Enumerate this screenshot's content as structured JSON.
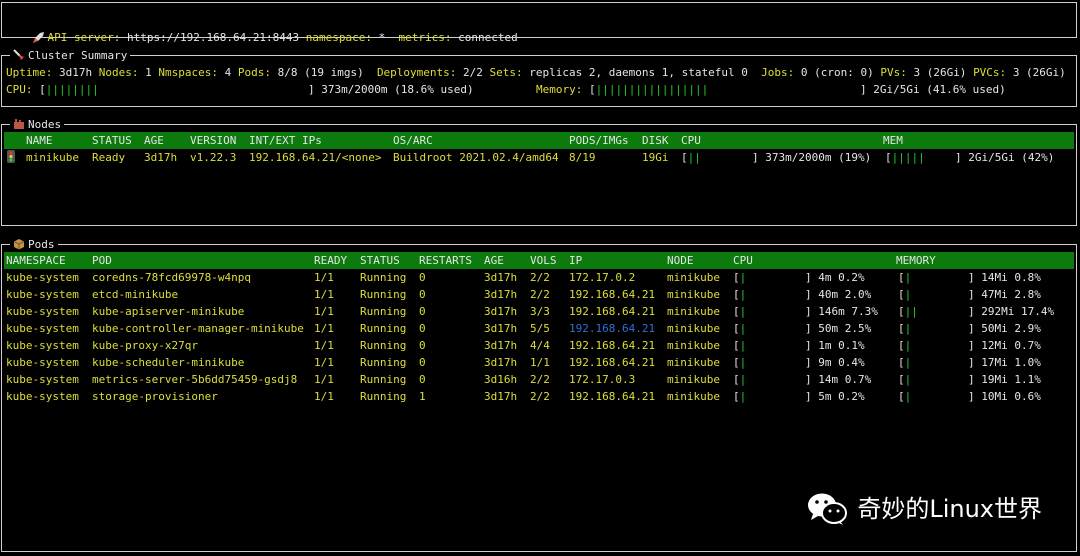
{
  "header": {
    "api_label": "API server:",
    "api_value": "https://192.168.64.21:8443",
    "ns_label": "namespace:",
    "ns_value": "*",
    "metrics_label": "metrics:",
    "metrics_value": "connected"
  },
  "cluster": {
    "title": "Cluster Summary",
    "uptime_label": "Uptime:",
    "uptime": "3d17h",
    "nodes_label": "Nodes:",
    "nodes": "1",
    "nmspaces_label": "Nmspaces:",
    "nmspaces": "4",
    "pods_label": "Pods:",
    "pods": "8/8 (19 imgs)",
    "deployments_label": "Deployments:",
    "deployments": "2/2",
    "sets_label": "Sets:",
    "sets": "replicas 2, daemons 1, stateful 0",
    "jobs_label": "Jobs:",
    "jobs": "0 (cron: 0)",
    "pvs_label": "PVs:",
    "pvs": "3 (26Gi)",
    "pvcs_label": "PVCs:",
    "pvcs": "3 (26Gi)",
    "cpu_label": "CPU:",
    "cpu_bar": "||||||||",
    "cpu_value": "373m/2000m (18.6% used)",
    "mem_label": "Memory:",
    "mem_bar": "|||||||||||||||||",
    "mem_value": "2Gi/5Gi (41.6% used)"
  },
  "nodes": {
    "title": "Nodes",
    "columns": [
      "NAME",
      "STATUS",
      "AGE",
      "VERSION",
      "INT/EXT IPs",
      "OS/ARC",
      "PODS/IMGs",
      "DISK",
      "CPU",
      "MEM"
    ],
    "rows": [
      {
        "name": "minikube",
        "status": "Ready",
        "age": "3d17h",
        "version": "v1.22.3",
        "ips": "192.168.64.21/<none>",
        "os": "Buildroot 2021.02.4/amd64",
        "pods": "8/19",
        "disk": "19Gi",
        "cpu_bar": "||",
        "cpu_value": "373m/2000m (19%)",
        "mem_bar": "|||||",
        "mem_value": "2Gi/5Gi (42%)"
      }
    ]
  },
  "pods": {
    "title": "Pods",
    "columns": [
      "NAMESPACE",
      "POD",
      "READY",
      "STATUS",
      "RESTARTS",
      "AGE",
      "VOLS",
      "IP",
      "NODE",
      "CPU",
      "MEMORY"
    ],
    "rows": [
      {
        "ns": "kube-system",
        "pod": "coredns-78fcd69978-w4npq",
        "ready": "1/1",
        "status": "Running",
        "restarts": "0",
        "age": "3d17h",
        "vols": "2/2",
        "ip": "172.17.0.2",
        "node": "minikube",
        "cpu_bar": "|",
        "cpu": "4m 0.2%",
        "mem_bar": "|",
        "mem": "14Mi 0.8%"
      },
      {
        "ns": "kube-system",
        "pod": "etcd-minikube",
        "ready": "1/1",
        "status": "Running",
        "restarts": "0",
        "age": "3d17h",
        "vols": "2/2",
        "ip": "192.168.64.21",
        "node": "minikube",
        "cpu_bar": "|",
        "cpu": "40m 2.0%",
        "mem_bar": "|",
        "mem": "47Mi 2.8%"
      },
      {
        "ns": "kube-system",
        "pod": "kube-apiserver-minikube",
        "ready": "1/1",
        "status": "Running",
        "restarts": "0",
        "age": "3d17h",
        "vols": "3/3",
        "ip": "192.168.64.21",
        "node": "minikube",
        "cpu_bar": "|",
        "cpu": "146m 7.3%",
        "mem_bar": "||",
        "mem": "292Mi 17.4%"
      },
      {
        "ns": "kube-system",
        "pod": "kube-controller-manager-minikube",
        "ready": "1/1",
        "status": "Running",
        "restarts": "0",
        "age": "3d17h",
        "vols": "5/5",
        "ip": "192.168.64.21",
        "node": "minikube",
        "cpu_bar": "|",
        "cpu": "50m 2.5%",
        "mem_bar": "|",
        "mem": "50Mi 2.9%"
      },
      {
        "ns": "kube-system",
        "pod": "kube-proxy-x27qr",
        "ready": "1/1",
        "status": "Running",
        "restarts": "0",
        "age": "3d17h",
        "vols": "4/4",
        "ip": "192.168.64.21",
        "node": "minikube",
        "cpu_bar": "|",
        "cpu": "1m 0.1%",
        "mem_bar": "|",
        "mem": "12Mi 0.7%"
      },
      {
        "ns": "kube-system",
        "pod": "kube-scheduler-minikube",
        "ready": "1/1",
        "status": "Running",
        "restarts": "0",
        "age": "3d17h",
        "vols": "1/1",
        "ip": "192.168.64.21",
        "node": "minikube",
        "cpu_bar": "|",
        "cpu": "9m 0.4%",
        "mem_bar": "|",
        "mem": "17Mi 1.0%"
      },
      {
        "ns": "kube-system",
        "pod": "metrics-server-5b6dd75459-gsdj8",
        "ready": "1/1",
        "status": "Running",
        "restarts": "0",
        "age": "3d16h",
        "vols": "2/2",
        "ip": "172.17.0.3",
        "node": "minikube",
        "cpu_bar": "|",
        "cpu": "14m 0.7%",
        "mem_bar": "|",
        "mem": "19Mi 1.1%"
      },
      {
        "ns": "kube-system",
        "pod": "storage-provisioner",
        "ready": "1/1",
        "status": "Running",
        "restarts": "1",
        "age": "3d17h",
        "vols": "2/2",
        "ip": "192.168.64.21",
        "node": "minikube",
        "cpu_bar": "|",
        "cpu": "5m 0.2%",
        "mem_bar": "|",
        "mem": "10Mi 0.6%"
      }
    ]
  },
  "watermark": {
    "text": "奇妙的Linux世界"
  },
  "colors": {
    "header_bg": "#0c7a0c",
    "yellow": "#dede3a",
    "green": "#28c828",
    "blue": "#2f6fd6"
  }
}
